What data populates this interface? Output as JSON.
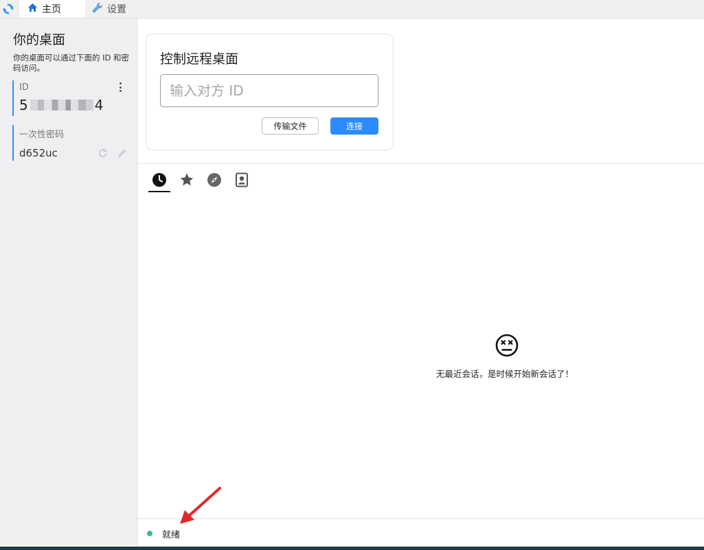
{
  "app": {
    "logo_icon": "rustdesk-logo-icon",
    "tabs": [
      {
        "label": "主页",
        "icon": "home-icon",
        "active": true
      },
      {
        "label": "设置",
        "icon": "wrench-icon",
        "active": false
      }
    ]
  },
  "sidebar": {
    "title": "你的桌面",
    "description": "你的桌面可以通过下面的 ID 和密码访问。",
    "id_label": "ID",
    "id_prefix": "5",
    "id_suffix": "4",
    "password_label": "一次性密码",
    "password_value": "d652uc"
  },
  "remote": {
    "title": "控制远程桌面",
    "input_placeholder": "输入对方 ID",
    "transfer_button": "传输文件",
    "connect_button": "连接"
  },
  "session_tabs": [
    {
      "name": "recent",
      "icon": "clock-icon",
      "active": true
    },
    {
      "name": "favorites",
      "icon": "star-icon",
      "active": false
    },
    {
      "name": "discovered",
      "icon": "compass-icon",
      "active": false
    },
    {
      "name": "address-book",
      "icon": "contact-icon",
      "active": false
    }
  ],
  "empty_state": {
    "icon": "dizzy-face-icon",
    "message": "无最近会话，是时候开始新会话了！"
  },
  "status": {
    "text": "就绪",
    "color": "#32bb9c"
  },
  "colors": {
    "accent": "#2c8cff",
    "sidebar_bg": "#efeff2"
  }
}
